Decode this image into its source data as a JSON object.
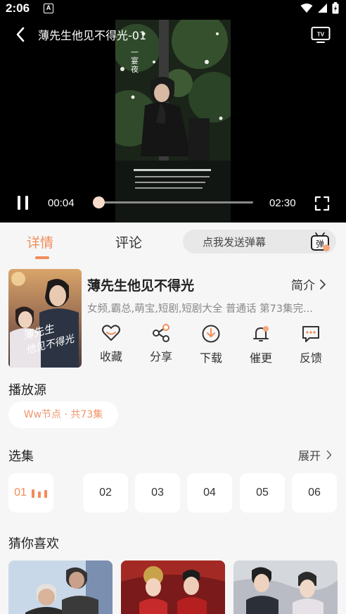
{
  "status_bar": {
    "time": "2:06",
    "notification": "A"
  },
  "player": {
    "title": "薄先生他见不得光-01",
    "current_time": "00:04",
    "total_time": "02:30",
    "progress_fraction": 0.0267,
    "tv_label": "TV"
  },
  "tabs": {
    "details": "详情",
    "comments": "评论"
  },
  "danmaku": {
    "placeholder": "点我发送弹幕",
    "icon_label": "弹"
  },
  "drama": {
    "title": "薄先生他见不得光",
    "intro_label": "简介",
    "tags": "女频,霸总,萌宝,短剧,短剧大全 普通话 第73集完...",
    "poster_text": "薄先生他见不得光"
  },
  "actions": [
    {
      "label": "收藏",
      "icon": "heart-icon"
    },
    {
      "label": "分享",
      "icon": "share-icon"
    },
    {
      "label": "下载",
      "icon": "download-icon"
    },
    {
      "label": "催更",
      "icon": "bell-icon"
    },
    {
      "label": "反馈",
      "icon": "feedback-icon"
    }
  ],
  "source": {
    "section_title": "播放源",
    "chip": "Ww节点 · 共73集"
  },
  "episodes": {
    "section_title": "选集",
    "expand_label": "展开",
    "items": [
      "01",
      "02",
      "03",
      "04",
      "05",
      "06"
    ],
    "active_index": 0
  },
  "recommend": {
    "section_title": "猜你喜欢"
  },
  "colors": {
    "accent": "#f28c5a",
    "background": "#f6f6f6"
  }
}
